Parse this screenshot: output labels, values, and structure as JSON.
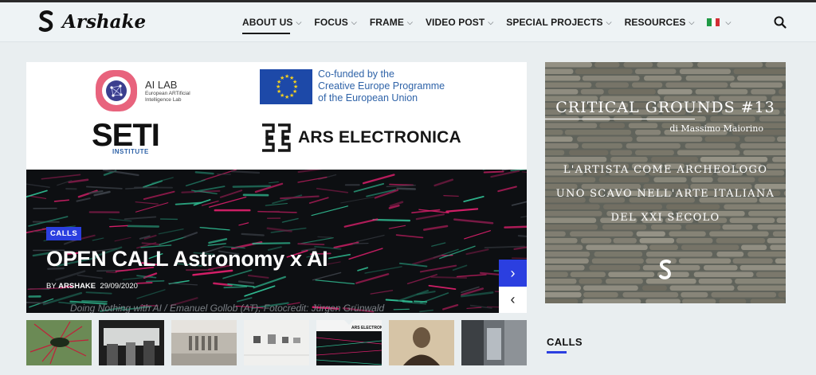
{
  "site": {
    "name": "Arshake"
  },
  "nav": [
    {
      "label": "ABOUT US",
      "active": true
    },
    {
      "label": "FOCUS"
    },
    {
      "label": "FRAME"
    },
    {
      "label": "VIDEO POST"
    },
    {
      "label": "SPECIAL PROJECTS"
    },
    {
      "label": "RESOURCES"
    }
  ],
  "language": {
    "flag_colors": [
      "#1f9a45",
      "#ffffff",
      "#d22f36"
    ]
  },
  "icons": {
    "search": "search-icon",
    "chevron": "chevron-down-icon",
    "next": "chevron-right-icon",
    "prev": "chevron-left-icon"
  },
  "sponsors": {
    "ailab": {
      "title": "AI LAB",
      "subtitle": "European ARTificial Intelligence Lab"
    },
    "eu": {
      "text_line1": "Co-funded by the",
      "text_line2": "Creative Europe Programme",
      "text_line3": "of the European Union"
    },
    "seti": {
      "main": "SETI",
      "sub": "INSTITUTE"
    },
    "ars": {
      "text": "ARS ELECTRONICA"
    }
  },
  "slide": {
    "category": "CALLS",
    "title": "OPEN CALL Astronomy x AI",
    "author_prefix": "BY",
    "author": "ARSHAKE",
    "date": "29/09/2020",
    "caption": "Doing Nothing with AI / Emanuel Gollob (AT), Fotocredit: Jürgen Grünwald"
  },
  "thumbnails": [
    {
      "name": "thumb-1"
    },
    {
      "name": "thumb-2"
    },
    {
      "name": "thumb-3"
    },
    {
      "name": "thumb-4"
    },
    {
      "name": "thumb-5",
      "active": true
    },
    {
      "name": "thumb-6"
    },
    {
      "name": "thumb-7"
    }
  ],
  "ad": {
    "heading": "CRITICAL GROUNDS #13",
    "subheading": "di Massimo Maiorino",
    "line1": "L'ARTISTA COME ARCHEOLOGO",
    "line2": "UNO SCAVO NELL'ARTE ITALIANA",
    "line3": "DEL XXI SECOLO"
  },
  "sidebar": {
    "calls_heading": "CALLS"
  },
  "colors": {
    "accent": "#2b3fe0",
    "eu_blue": "#1d49a8",
    "ailab_pink": "#e8637d"
  }
}
